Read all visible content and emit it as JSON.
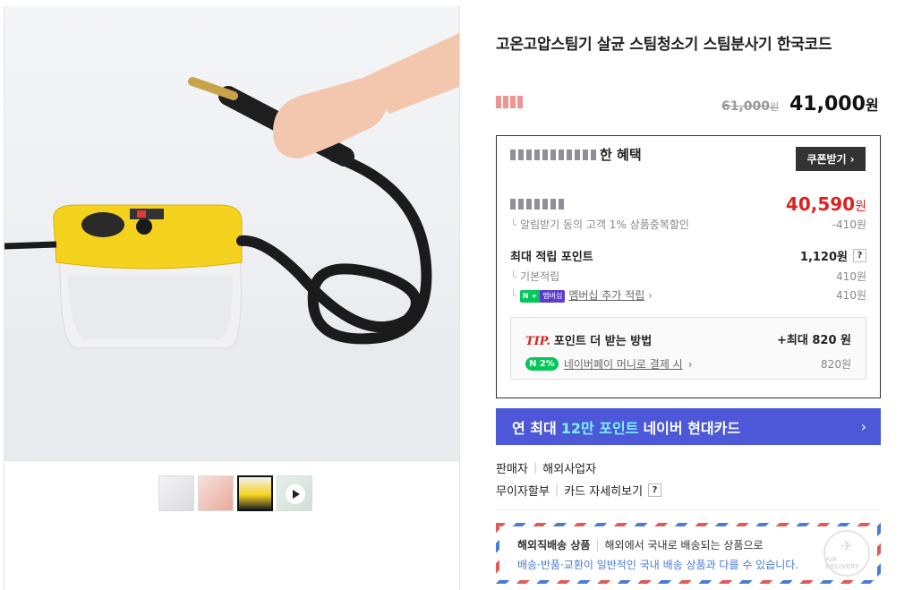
{
  "product": {
    "title": "고온고압스팀기 살균 스팀청소기 스팀분사기 한국코드",
    "original_price": "61,000",
    "original_price_unit": "원",
    "sale_price": "41,000",
    "sale_price_unit": "원"
  },
  "benefit": {
    "header_suffix": "한 혜택",
    "coupon_button": "쿠폰받기",
    "best_price": "40,590",
    "best_price_unit": "원",
    "alarm_discount_label": "알림받기 동의 고객 1% 상품중복할인",
    "alarm_discount_value": "-410원",
    "points_title": "최대 적립 포인트",
    "points_total": "1,120원",
    "help_mark": "?",
    "base_points_label": "기본적립",
    "base_points_value": "410원",
    "membership_badge_n": "N +",
    "membership_badge_text": "멤버십",
    "membership_points_label": "멤버십 추가 적립",
    "membership_points_value": "410원",
    "tip_label": "TIP.",
    "tip_title": "포인트 더 받는 방법",
    "tip_max": "+최대 820 원",
    "npay_badge": "N 2%",
    "npay_label": "네이버페이 머니로 결제 시",
    "npay_value": "820원"
  },
  "card_banner": {
    "prefix": "연 최대",
    "highlight": "12만 포인트",
    "suffix": "네이버 현대카드",
    "arrow": "›"
  },
  "seller": {
    "label": "판매자",
    "value": "해외사업자"
  },
  "installment": {
    "label": "무이자할부",
    "link": "카드 자세히보기",
    "help": "?"
  },
  "overseas": {
    "title": "해외직배송 상품",
    "desc": "해외에서 국내로 배송되는 상품으로",
    "notice": "배송·반품·교환이 일반적인 국내 배송 상품과 다를 수 있습니다.",
    "stamp_text": "AIR DELIVERY"
  },
  "colors": {
    "accent_red": "#e02020",
    "card_blue": "#4c58d8",
    "naver_green": "#03c75a"
  }
}
